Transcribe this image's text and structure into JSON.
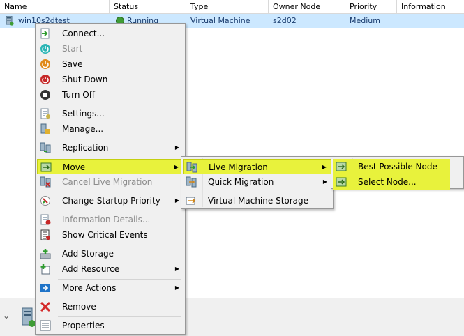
{
  "columns": [
    "Name",
    "Status",
    "Type",
    "Owner Node",
    "Priority",
    "Information"
  ],
  "row": {
    "name": "win10s2dtest",
    "status": "Running",
    "type": "Virtual Machine",
    "owner_node": "s2d02",
    "priority": "Medium",
    "information": ""
  },
  "context_menu": {
    "items": [
      {
        "label": "Connect...",
        "icon": "connect-icon",
        "disabled": false
      },
      {
        "label": "Start",
        "icon": "start-icon",
        "disabled": true
      },
      {
        "label": "Save",
        "icon": "save-icon",
        "disabled": false
      },
      {
        "label": "Shut Down",
        "icon": "shutdown-icon",
        "disabled": false
      },
      {
        "label": "Turn Off",
        "icon": "turn-off-icon",
        "disabled": false
      },
      {
        "label": "Settings...",
        "icon": "settings-icon",
        "disabled": false
      },
      {
        "label": "Manage...",
        "icon": "manage-icon",
        "disabled": false
      },
      {
        "label": "Replication",
        "icon": "replication-icon",
        "disabled": false,
        "submenu": true
      },
      {
        "label": "Move",
        "icon": "move-icon",
        "disabled": false,
        "submenu": true,
        "highlighted": true
      },
      {
        "label": "Cancel Live Migration",
        "icon": "cancel-migration-icon",
        "disabled": true
      },
      {
        "label": "Change Startup Priority",
        "icon": "startup-priority-icon",
        "disabled": false,
        "submenu": true
      },
      {
        "label": "Information Details...",
        "icon": "info-details-icon",
        "disabled": true
      },
      {
        "label": "Show Critical Events",
        "icon": "critical-events-icon",
        "disabled": false
      },
      {
        "label": "Add Storage",
        "icon": "add-storage-icon",
        "disabled": false
      },
      {
        "label": "Add Resource",
        "icon": "add-resource-icon",
        "disabled": false,
        "submenu": true
      },
      {
        "label": "More Actions",
        "icon": "more-actions-icon",
        "disabled": false,
        "submenu": true
      },
      {
        "label": "Remove",
        "icon": "remove-icon",
        "disabled": false
      },
      {
        "label": "Properties",
        "icon": "properties-icon",
        "disabled": false
      }
    ]
  },
  "move_submenu": {
    "items": [
      {
        "label": "Live Migration",
        "icon": "live-migration-icon",
        "submenu": true,
        "highlighted": true
      },
      {
        "label": "Quick Migration",
        "icon": "quick-migration-icon",
        "submenu": true
      },
      {
        "label": "Virtual Machine Storage",
        "icon": "vm-storage-icon"
      }
    ]
  },
  "live_migration_submenu": {
    "items": [
      {
        "label": "Best Possible Node",
        "icon": "best-node-icon"
      },
      {
        "label": "Select Node...",
        "icon": "select-node-icon"
      }
    ]
  },
  "colors": {
    "highlight": "#e8f23c",
    "selection_row": "#cce8ff",
    "menu_bg": "#f0f0f0",
    "disabled_text": "#8d8d8d"
  }
}
